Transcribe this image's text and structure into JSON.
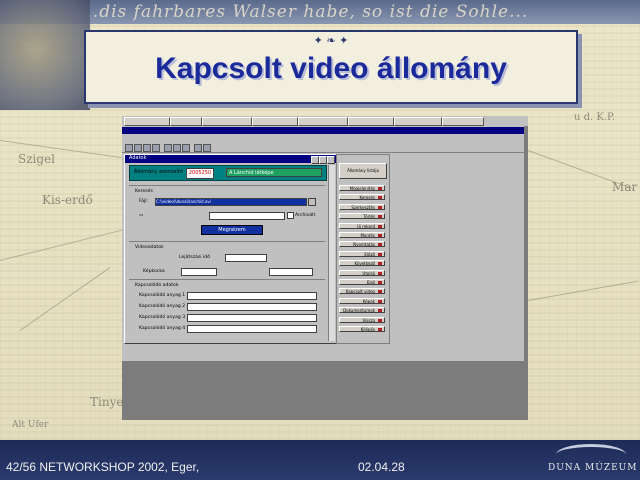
{
  "slide": {
    "title": "Kapcsolt video állomány",
    "banner_script": "...dis fahrbares Walser habe, so ist die Sohle...",
    "footer_left": "42/56 NETWORKSHOP 2002, Eger,",
    "footer_date": "02.04.28",
    "logo_text": "DUNA MÚZEUM"
  },
  "map_labels": [
    "Szigel",
    "Kis-erdő",
    "Tinye",
    "Mar",
    "Alt Ufer",
    "u d. K.P."
  ],
  "screenshot": {
    "form_title": "Adatok",
    "record_label": "Állomány azonosító",
    "record_number": "2005250",
    "record_name": "A Lánchíd látképe",
    "section_search": "Keresés",
    "search_prefix": "Fájl:",
    "search_value": "C:\\\\video\\\\duna\\\\lanchid.avi",
    "checkbox_label": "Archivált",
    "view_button": "Megnézem",
    "section_video": "Videoadatok",
    "length_label": "Lejátszási idő",
    "frames_label": "Képkocka",
    "section_keywords": "Kapcsolódó adatok",
    "keyword_labels": [
      "Kapcsolódó anyag 1",
      "Kapcsolódó anyag 2",
      "Kapcsolódó anyag 3",
      "Kapcsolódó anyag 4"
    ],
    "panel_top_button": "Állomány listája",
    "panel_buttons": [
      "Megjelenítés",
      "Keresés",
      "Szerkesztés",
      "Törlés",
      "Új rekord",
      "Mentés",
      "Nyomtatás",
      "Előző",
      "Következő",
      "Utolsó",
      "Első",
      "Kapcsolt video",
      "Képek",
      "Dokumentumok",
      "Vissza",
      "Kilépés"
    ]
  },
  "colors": {
    "title_text": "#1b2a9a",
    "footer_bg": "#1d2b58",
    "win_titlebar": "#000080",
    "record_bar": "#008080"
  }
}
